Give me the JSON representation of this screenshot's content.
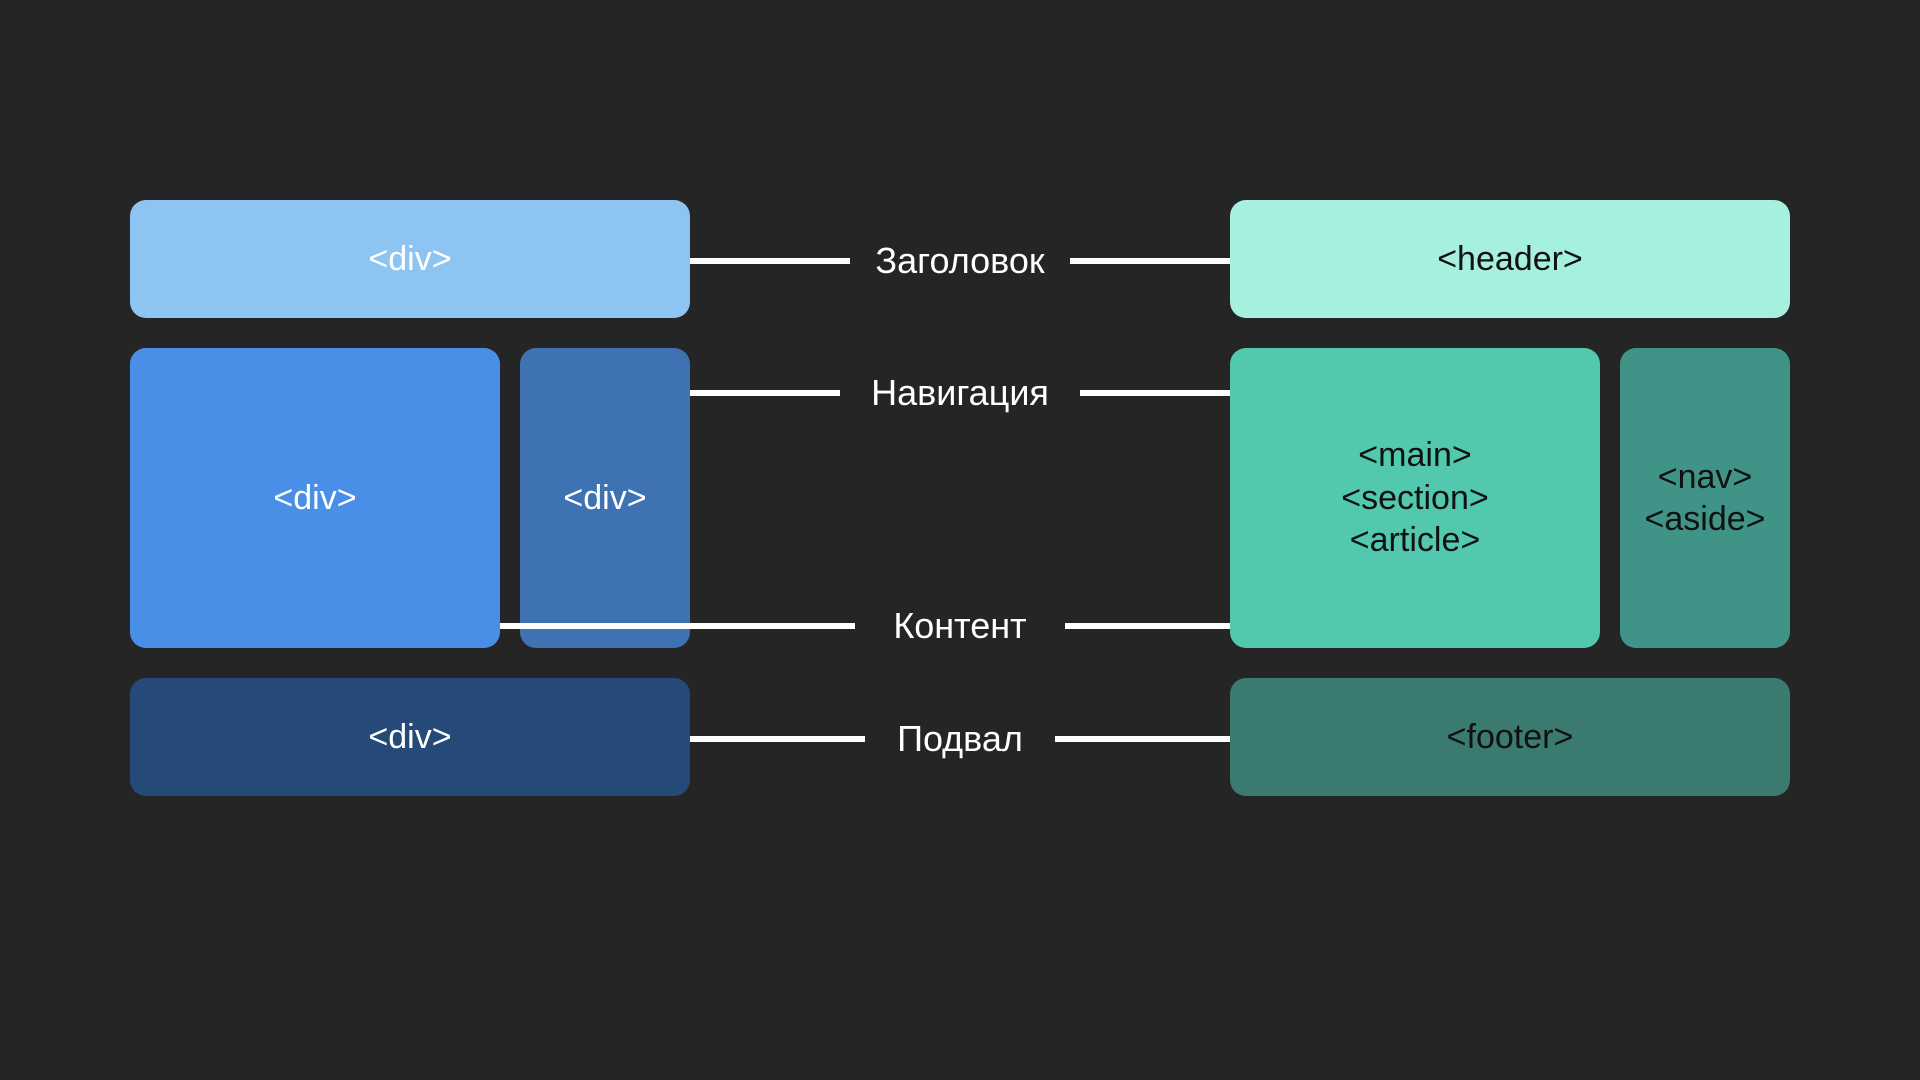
{
  "leftColumn": {
    "header": "<div>",
    "content": "<div>",
    "sidebar": "<div>",
    "footer": "<div>"
  },
  "rightColumn": {
    "header": "<header>",
    "content": [
      "<main>",
      "<section>",
      "<article>"
    ],
    "sidebar": [
      "<nav>",
      "<aside>"
    ],
    "footer": "<footer>"
  },
  "labels": {
    "header": "Заголовок",
    "navigation": "Навигация",
    "content": "Контент",
    "footer": "Подвал"
  }
}
